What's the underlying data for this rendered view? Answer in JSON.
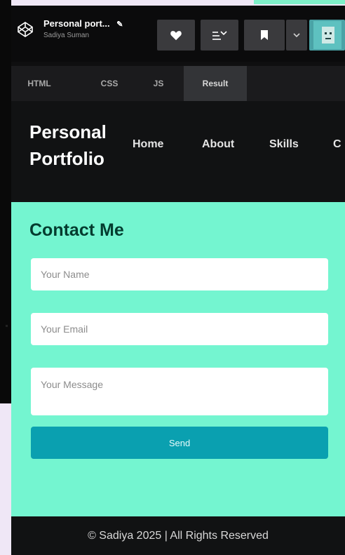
{
  "pen": {
    "title": "Personal port...",
    "author": "Sadiya Suman"
  },
  "editor_tabs": [
    "HTML",
    "CSS",
    "JS",
    "Result"
  ],
  "site": {
    "brand": "Personal Portfolio",
    "nav": [
      "Home",
      "About",
      "Skills",
      "C"
    ],
    "contact": {
      "title": "Contact Me",
      "name_placeholder": "Your Name",
      "email_placeholder": "Your Email",
      "message_placeholder": "Your Message",
      "send_label": "Send"
    },
    "footer": "© Sadiya 2025 | All Rights Reserved"
  },
  "icons": [
    "codepen-logo-icon",
    "pencil-icon",
    "heart-icon",
    "layout-icon",
    "bookmark-icon",
    "chevron-down-icon",
    "avatar"
  ],
  "colors": {
    "accent_bg": "#74f5d0",
    "button": "#0aa0b0",
    "dark": "#111213",
    "heading": "#043c2f"
  }
}
